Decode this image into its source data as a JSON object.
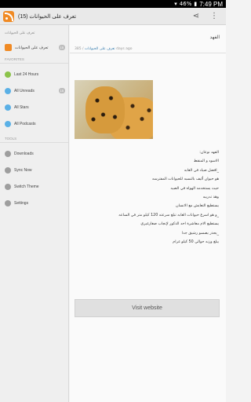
{
  "status_bar": {
    "time": "7:49 PM",
    "battery": "46%"
  },
  "action_bar": {
    "title": "تعرف على الحيوانات (15)",
    "share_icon": "share-icon",
    "menu_icon": "overflow-menu-icon"
  },
  "sidebar": {
    "account_label": "تعرف على الحيوانات",
    "feed": {
      "label": "تعرف على الحيوانات",
      "count": "15"
    },
    "favorites_header": "FAVORITES",
    "favorites": [
      {
        "label": "Last 24 Hours",
        "icon": "clock-icon"
      },
      {
        "label": "All Unreads",
        "icon": "unread-icon",
        "count": "15"
      },
      {
        "label": "All Stars",
        "icon": "star-icon"
      },
      {
        "label": "All Podcasts",
        "icon": "podcast-icon"
      }
    ],
    "tools_header": "TOOLS",
    "tools": [
      {
        "label": "Downloads",
        "icon": "download-icon"
      },
      {
        "label": "Sync Now",
        "icon": "sync-icon"
      },
      {
        "label": "Switch Theme",
        "icon": "theme-icon"
      },
      {
        "label": "Settings",
        "icon": "gear-icon"
      }
    ]
  },
  "article": {
    "title": "الفهد",
    "meta_count": "385 /",
    "meta_source": "تعرف على الحيوانات",
    "meta_time": "days ago",
    "lines": [
      "الفهد نوعان:",
      "الاسود و المنقط",
      "_افضل صياد في الغابه",
      "هو حيوان أليف بالنسبه للحيوانات المفترسه",
      "حيث يستخدمه الهواه في الصيد",
      "وهذ تدريبه",
      "يستطيع التعايش مع الانسان",
      "_و هو اسرع حيوانات الغابه تبلغ سرعته 120 كيلو متر في الساعه",
      "يستطيع الام معاشرة احد الذكور لإنجاب صغارغيري",
      "_يحذر يصسو رشيق جدا",
      "يبلغ وزنه حوالي 50 كيلو غرام"
    ],
    "visit_label": "Visit website"
  }
}
